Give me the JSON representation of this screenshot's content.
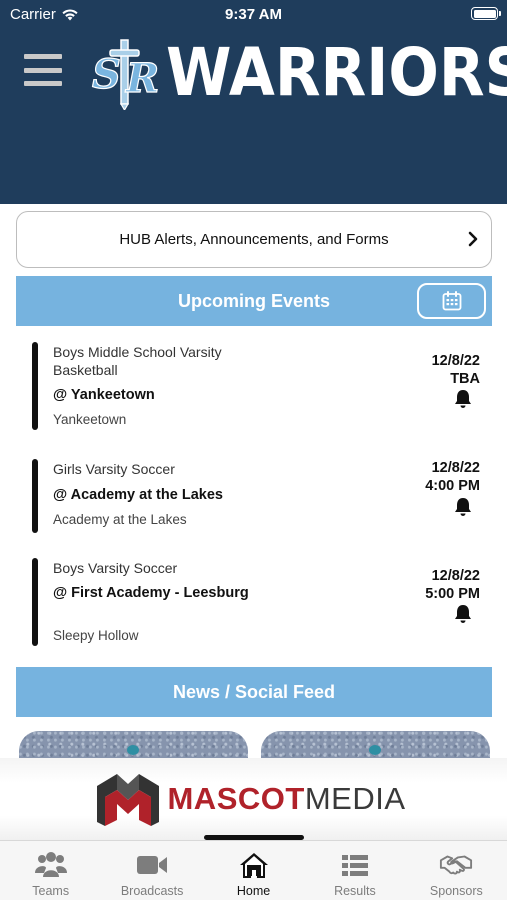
{
  "status_bar": {
    "carrier": "Carrier",
    "time": "9:37 AM"
  },
  "header": {
    "logo_monogram": "SR",
    "logo_text": "WARRIORS",
    "background_color": "#1f3d5c"
  },
  "alerts": {
    "label": "HUB Alerts, Announcements, and Forms"
  },
  "upcoming": {
    "title": "Upcoming Events",
    "accent_color": "#76b3df",
    "events": [
      {
        "sport": "Boys Middle School Varsity Basketball",
        "opponent": "@ Yankeetown",
        "location": "Yankeetown",
        "date": "12/8/22",
        "time": "TBA"
      },
      {
        "sport": "Girls Varsity Soccer",
        "opponent": "@ Academy at the Lakes",
        "location": "Academy at the Lakes",
        "date": "12/8/22",
        "time": "4:00 PM"
      },
      {
        "sport": "Boys Varsity Soccer",
        "opponent": "@ First Academy - Leesburg",
        "location": "Sleepy Hollow",
        "date": "12/8/22",
        "time": "5:00 PM"
      }
    ]
  },
  "news": {
    "title": "News / Social Feed"
  },
  "sponsor": {
    "word1": "MASCOT",
    "word2": "MEDIA",
    "brand_color": "#b0222a"
  },
  "tabs": [
    {
      "label": "Teams",
      "icon": "people-icon"
    },
    {
      "label": "Broadcasts",
      "icon": "video-camera-icon"
    },
    {
      "label": "Home",
      "icon": "house-icon",
      "active": true
    },
    {
      "label": "Results",
      "icon": "list-icon"
    },
    {
      "label": "Sponsors",
      "icon": "handshake-icon"
    }
  ]
}
